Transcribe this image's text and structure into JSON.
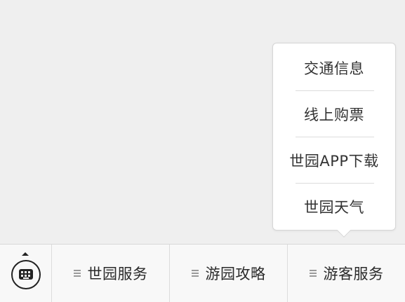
{
  "submenu": {
    "items": [
      {
        "label": "交通信息"
      },
      {
        "label": "线上购票"
      },
      {
        "label": "世园APP下载"
      },
      {
        "label": "世园天气"
      }
    ]
  },
  "menubar": {
    "keyboard_icon": "keyboard-icon",
    "tabs": [
      {
        "label": "世园服务",
        "icon": "menu-lines-icon"
      },
      {
        "label": "游园攻略",
        "icon": "menu-lines-icon"
      },
      {
        "label": "游客服务",
        "icon": "menu-lines-icon"
      }
    ]
  }
}
